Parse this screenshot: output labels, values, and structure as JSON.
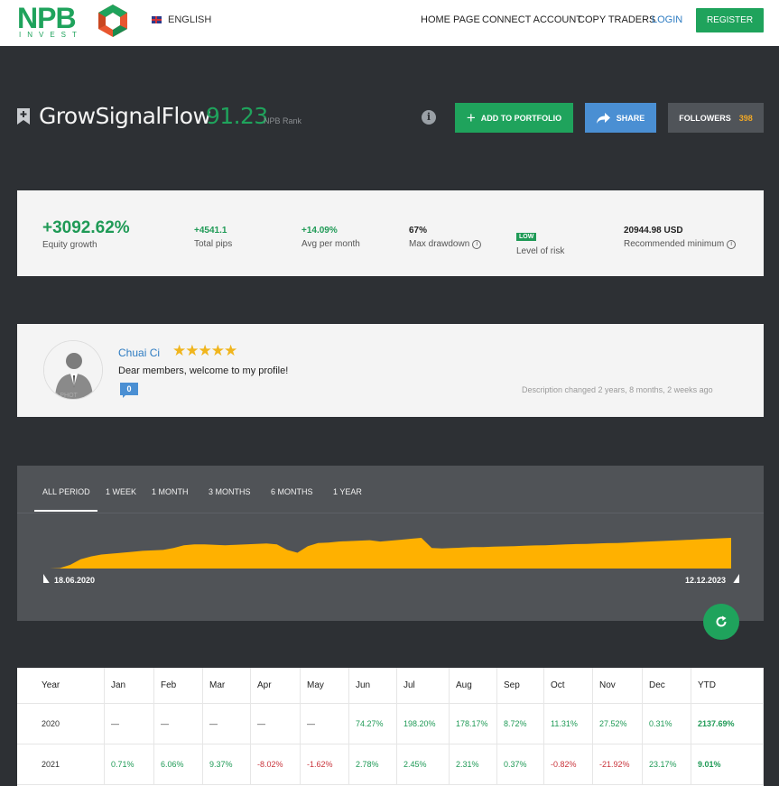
{
  "header": {
    "logo_text": "NPB",
    "logo_sub": "INVEST",
    "language": "ENGLISH",
    "nav": [
      "HOME PAGE",
      "CONNECT ACCOUNT",
      "COPY TRADERS",
      "LOGIN"
    ],
    "register_label": "REGISTER"
  },
  "trader": {
    "name": "GrowSignalFlow",
    "rank": "91.23",
    "rank_label": "NPB Rank",
    "info_glyph": "i",
    "add_portfolio_label": "ADD TO PORTFOLIO",
    "share_label": "SHARE",
    "followers_label": "FOLLOWERS",
    "followers_count": "398"
  },
  "stats": {
    "equity_growth": {
      "value": "+3092.62%",
      "label": "Equity growth"
    },
    "total_pips": {
      "value": "+4541.1",
      "label": "Total pips"
    },
    "avg_per_month": {
      "value": "+14.09%",
      "label": "Avg per month"
    },
    "max_drawdown": {
      "value": "67%",
      "label": "Max drawdown"
    },
    "level_of_risk": {
      "value": "LOW",
      "label": "Level of risk"
    },
    "recommended_minimum": {
      "value": "20944.98 USD",
      "label": "Recommended minimum"
    }
  },
  "profile": {
    "name": "Chuai Ci",
    "stars": "★★★★★",
    "description": "Dear members, welcome to my profile!",
    "comments_count": "0",
    "description_changed": "Description changed 2 years, 8 months, 2 weeks ago",
    "avatar_caption": "O PHOT"
  },
  "chart": {
    "tabs": [
      "ALL PERIOD",
      "1 WEEK",
      "1 MONTH",
      "3 MONTHS",
      "6 MONTHS",
      "1 YEAR"
    ],
    "active_tab": "ALL PERIOD",
    "start_date": "18.06.2020",
    "end_date": "12.12.2023",
    "fill_color": "#ffb100"
  },
  "chart_data": {
    "type": "area",
    "x_range": [
      "18.06.2020",
      "12.12.2023"
    ],
    "values": [
      0,
      0.5,
      4,
      10,
      13,
      15,
      16,
      17,
      18,
      19,
      19.5,
      20,
      22,
      25,
      26,
      26,
      25.5,
      25,
      25.5,
      26,
      26.5,
      27,
      26,
      20,
      17,
      24,
      27.5,
      28,
      29,
      29.5,
      30,
      30.5,
      29,
      30,
      31,
      32,
      33,
      22,
      21.5,
      22,
      22.5,
      23,
      23,
      23.5,
      23.8,
      24,
      24.5,
      24.8,
      25,
      25.5,
      26,
      26.3,
      26.5,
      27,
      27.3,
      27.5,
      28,
      28.5,
      29,
      29.5,
      30,
      30.5,
      31,
      31.5,
      32,
      32.5,
      33
    ]
  },
  "returns_table": {
    "headers": [
      "Year",
      "Jan",
      "Feb",
      "Mar",
      "Apr",
      "May",
      "Jun",
      "Jul",
      "Aug",
      "Sep",
      "Oct",
      "Nov",
      "Dec",
      "YTD"
    ],
    "rows": [
      {
        "year": "2020",
        "cells": [
          "—",
          "—",
          "—",
          "—",
          "—",
          "74.27%",
          "198.20%",
          "178.17%",
          "8.72%",
          "11.31%",
          "27.52%",
          "0.31%"
        ],
        "ytd": "2137.69%"
      },
      {
        "year": "2021",
        "cells": [
          "0.71%",
          "6.06%",
          "9.37%",
          "-8.02%",
          "-1.62%",
          "2.78%",
          "2.45%",
          "2.31%",
          "0.37%",
          "-0.82%",
          "-21.92%",
          "23.17%"
        ],
        "ytd": "9.01%"
      }
    ]
  }
}
